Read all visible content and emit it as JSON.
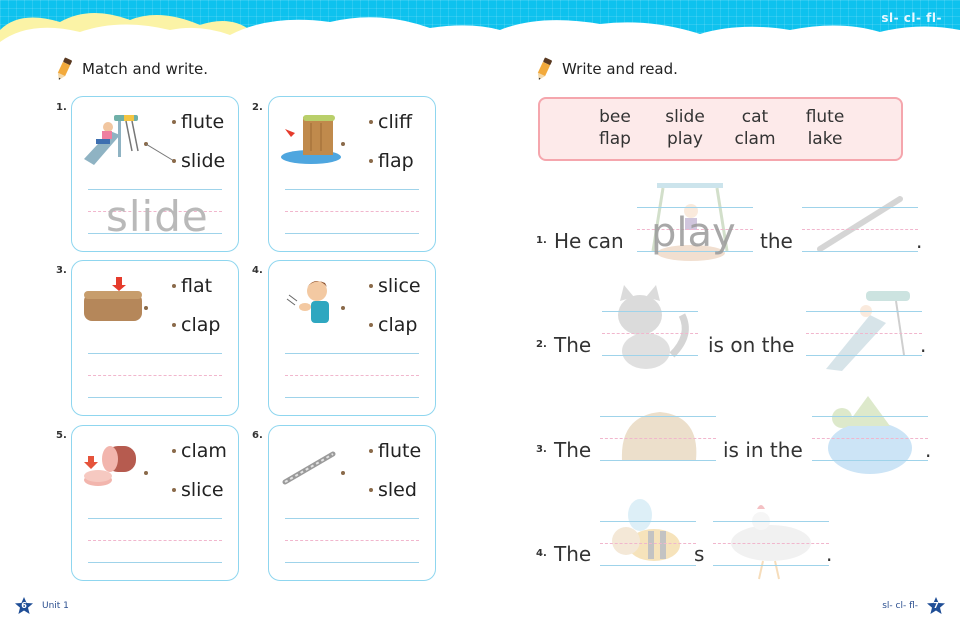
{
  "header": {
    "phonics_tag": "sl- cl- fl-"
  },
  "left_page": {
    "instruction": "Match and write.",
    "exercises": [
      {
        "number": "1.",
        "picture": "slide-icon",
        "options": [
          "flute",
          "slide"
        ],
        "answer_trace": "slide",
        "matched": "slide"
      },
      {
        "number": "2.",
        "picture": "cliff-icon",
        "options": [
          "cliff",
          "flap"
        ],
        "answer_trace": "",
        "matched": ""
      },
      {
        "number": "3.",
        "picture": "flat-icon",
        "options": [
          "flat",
          "clap"
        ],
        "answer_trace": "",
        "matched": ""
      },
      {
        "number": "4.",
        "picture": "clap-icon",
        "options": [
          "slice",
          "clap"
        ],
        "answer_trace": "",
        "matched": ""
      },
      {
        "number": "5.",
        "picture": "slice-icon",
        "options": [
          "clam",
          "slice"
        ],
        "answer_trace": "",
        "matched": ""
      },
      {
        "number": "6.",
        "picture": "flute-icon",
        "options": [
          "flute",
          "sled"
        ],
        "answer_trace": "",
        "matched": ""
      }
    ],
    "footer": {
      "page_number": "6",
      "unit_label": "Unit 1"
    }
  },
  "right_page": {
    "instruction": "Write and read.",
    "word_bank": [
      "bee",
      "slide",
      "cat",
      "flute",
      "flap",
      "play",
      "clam",
      "lake"
    ],
    "sentences": [
      {
        "number": "1.",
        "parts": [
          "He can",
          "the",
          "."
        ],
        "blank1_trace": "play",
        "blank1_picture": "swing-icon",
        "blank2_picture": "flute-icon"
      },
      {
        "number": "2.",
        "parts": [
          "The",
          "is on the",
          "."
        ],
        "blank1_trace": "",
        "blank1_picture": "cat-icon",
        "blank2_picture": "slide-icon"
      },
      {
        "number": "3.",
        "parts": [
          "The",
          "is in the",
          "."
        ],
        "blank1_trace": "",
        "blank1_picture": "clam-icon",
        "blank2_picture": "lake-icon"
      },
      {
        "number": "4.",
        "parts": [
          "The",
          "s",
          "."
        ],
        "blank1_trace": "",
        "blank1_picture": "bee-icon",
        "blank2_picture": "flap-icon"
      }
    ],
    "footer": {
      "page_number": "7",
      "phonics_tag": "sl- cl- fl-"
    }
  },
  "colors": {
    "sky": "#0ec2ee",
    "card_border": "#8fd6ef",
    "word_bank_border": "#f5a6ad",
    "word_bank_fill": "#fdeaea",
    "footer_blue": "#1f4e96"
  }
}
